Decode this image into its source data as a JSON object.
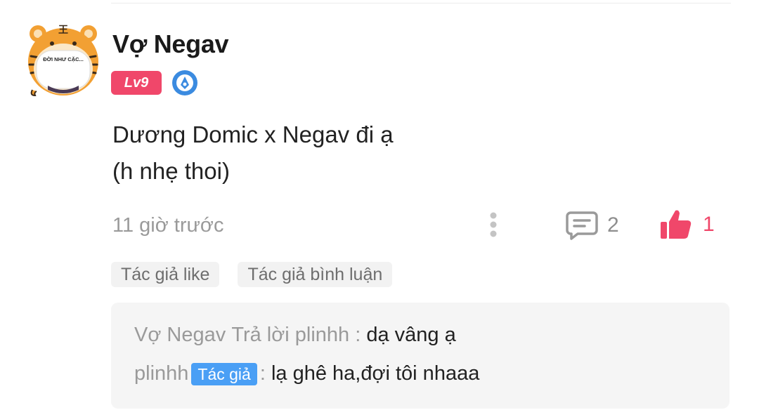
{
  "post": {
    "avatar_caption": "ĐỜI NHƯ CẶC...",
    "avatar_mark": "王",
    "username": "Vợ Negav",
    "level": "Lv9",
    "content_lines": [
      "Dương Domic x Negav đi ạ",
      "(h nhẹ thoi)"
    ],
    "timestamp": "11 giờ trước",
    "comment_count": "2",
    "like_count": "1"
  },
  "tags": [
    "Tác giả like",
    "Tác giả bình luận"
  ],
  "replies": [
    {
      "author": "Vợ Negav",
      "action": "Trả lời plinhh",
      "separator": ":",
      "text": "dạ vâng ạ"
    },
    {
      "author": "plinhh",
      "badge": "Tác giả",
      "separator": ":",
      "text": "lạ ghê ha,đợi tôi nhaaa"
    }
  ],
  "colors": {
    "accent": "#f0476a",
    "author_badge": "#4a9ff5",
    "muted": "#9a9a9a"
  },
  "icons": [
    "tiger-avatar",
    "medal-icon",
    "more-vertical-icon",
    "comment-icon",
    "thumbs-up-icon"
  ]
}
